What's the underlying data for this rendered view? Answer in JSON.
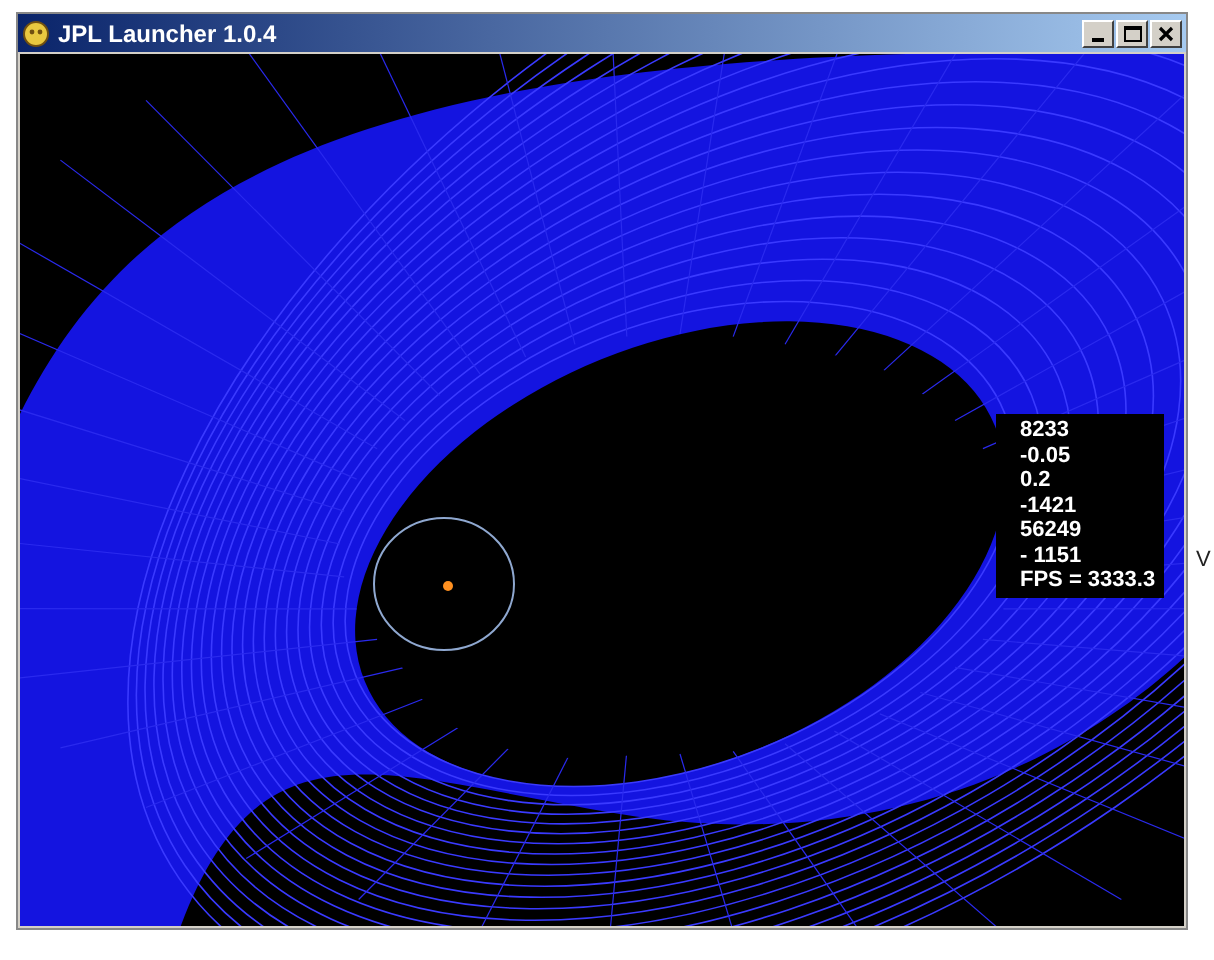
{
  "window": {
    "title": "JPL Launcher 1.0.4"
  },
  "stats": [
    "8233",
    "-0.05",
    "0.2",
    "-1421",
    "56249",
    "- 1151",
    "FPS = 3333.3"
  ],
  "desktop_text": "V"
}
